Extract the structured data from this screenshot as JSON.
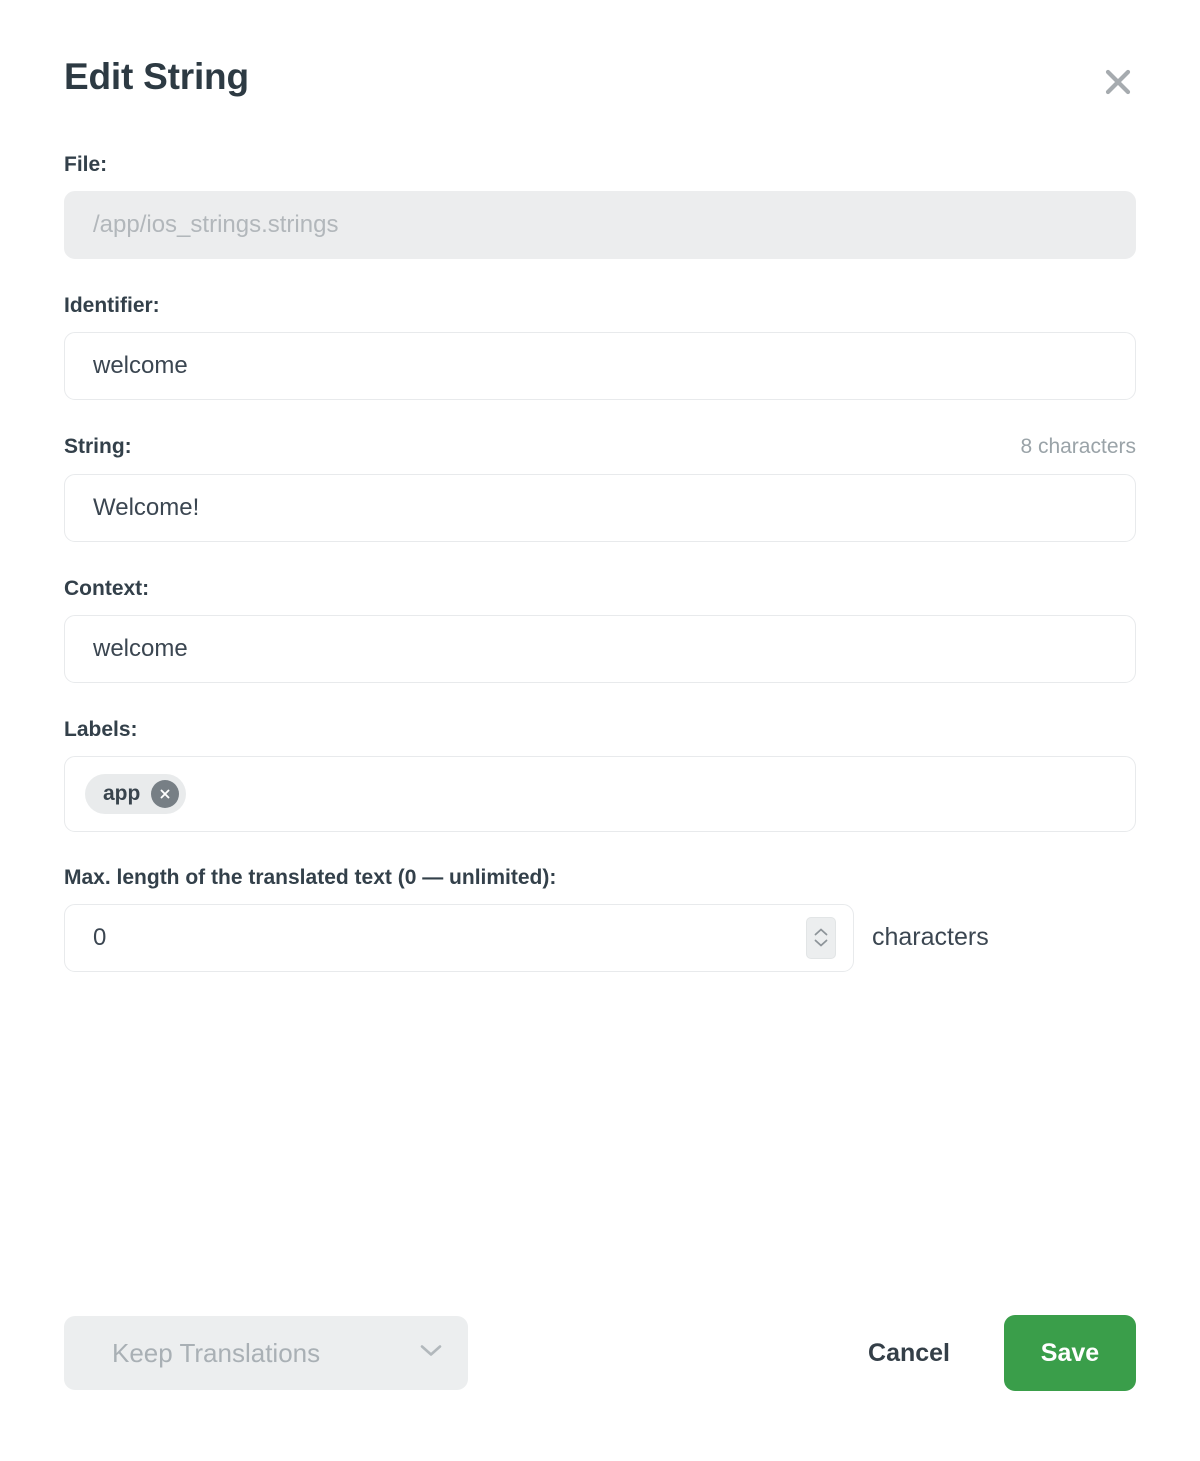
{
  "dialog": {
    "title": "Edit String",
    "close_icon": "close-icon"
  },
  "fields": {
    "file": {
      "label": "File:",
      "value": "/app/ios_strings.strings",
      "disabled": true
    },
    "identifier": {
      "label": "Identifier:",
      "value": "welcome"
    },
    "string": {
      "label": "String:",
      "value": "Welcome!",
      "counter": "8 characters"
    },
    "context": {
      "label": "Context:",
      "value": "welcome"
    },
    "labels": {
      "label": "Labels:",
      "tags": [
        {
          "text": "app",
          "remove_icon": "close-circle-icon"
        }
      ]
    },
    "max_length": {
      "label": "Max. length of the translated text (0 — unlimited):",
      "value": "0",
      "unit": "characters",
      "stepper_up_icon": "chevron-up-icon",
      "stepper_down_icon": "chevron-down-icon"
    }
  },
  "footer": {
    "translations_select": {
      "value": "Keep Translations",
      "chevron_icon": "chevron-down-icon",
      "disabled": true
    },
    "cancel_label": "Cancel",
    "save_label": "Save"
  },
  "colors": {
    "save_green": "#3a9e4a",
    "title_slate": "#2d3a43",
    "muted_gray": "#9aa3a8",
    "disabled_bg": "#ecedee"
  }
}
